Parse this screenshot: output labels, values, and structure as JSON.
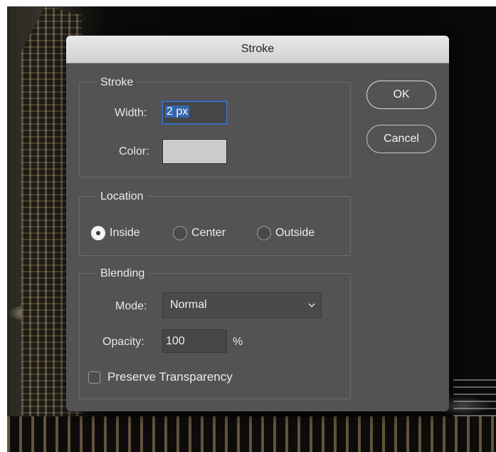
{
  "dialog": {
    "title": "Stroke",
    "ok_label": "OK",
    "cancel_label": "Cancel"
  },
  "stroke": {
    "legend": "Stroke",
    "width_label": "Width:",
    "width_value": "2 px",
    "color_label": "Color:",
    "color_swatch": "#cbcbcb"
  },
  "location": {
    "legend": "Location",
    "options": [
      "Inside",
      "Center",
      "Outside"
    ],
    "selected": "Inside"
  },
  "blending": {
    "legend": "Blending",
    "mode_label": "Mode:",
    "mode_value": "Normal",
    "opacity_label": "Opacity:",
    "opacity_value": "100",
    "opacity_unit": "%",
    "preserve_label": "Preserve Transparency",
    "preserve_checked": false
  }
}
